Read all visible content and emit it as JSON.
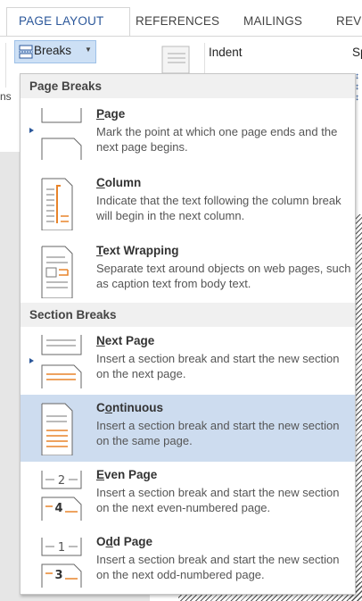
{
  "tabs": [
    {
      "label": "PAGE LAYOUT",
      "active": true
    },
    {
      "label": "REFERENCES",
      "active": false
    },
    {
      "label": "MAILINGS",
      "active": false
    },
    {
      "label": "REVI",
      "active": false
    }
  ],
  "ribbon": {
    "breaks_label": "Breaks",
    "indent_label": "Indent",
    "spacing_label": "Sp",
    "left_partial": "ns"
  },
  "menu": {
    "page_breaks_header": "Page Breaks",
    "section_breaks_header": "Section Breaks",
    "items": [
      {
        "underline": "P",
        "rest": "age",
        "desc": "Mark the point at which one page ends and the next page begins.",
        "icon": "page-break-icon"
      },
      {
        "underline": "C",
        "rest": "olumn",
        "desc": "Indicate that the text following the column break will begin in the next column.",
        "icon": "column-break-icon"
      },
      {
        "underline": "T",
        "rest": "ext Wrapping",
        "desc": "Separate text around objects on web pages, such as caption text from body text.",
        "icon": "text-wrapping-icon"
      },
      {
        "underline": "N",
        "rest": "ext Page",
        "desc": "Insert a section break and start the new section on the next page.",
        "icon": "next-page-icon"
      },
      {
        "pre": "C",
        "underline": "o",
        "rest": "ntinuous",
        "desc": "Insert a section break and start the new section on the same page.",
        "icon": "continuous-icon",
        "highlighted": true
      },
      {
        "underline": "E",
        "rest": "ven Page",
        "desc": "Insert a section break and start the new section on the next even-numbered page.",
        "icon": "even-page-icon"
      },
      {
        "pre": "O",
        "underline": "d",
        "rest": "d Page",
        "desc": "Insert a section break and start the new section on the next odd-numbered page.",
        "icon": "odd-page-icon"
      }
    ]
  },
  "colors": {
    "accent": "#2b579a",
    "highlight": "#cddcef",
    "orange": "#e8842a"
  },
  "icon_numbers": {
    "even_top": "2",
    "even_bottom": "4",
    "odd_top": "1",
    "odd_bottom": "3"
  }
}
